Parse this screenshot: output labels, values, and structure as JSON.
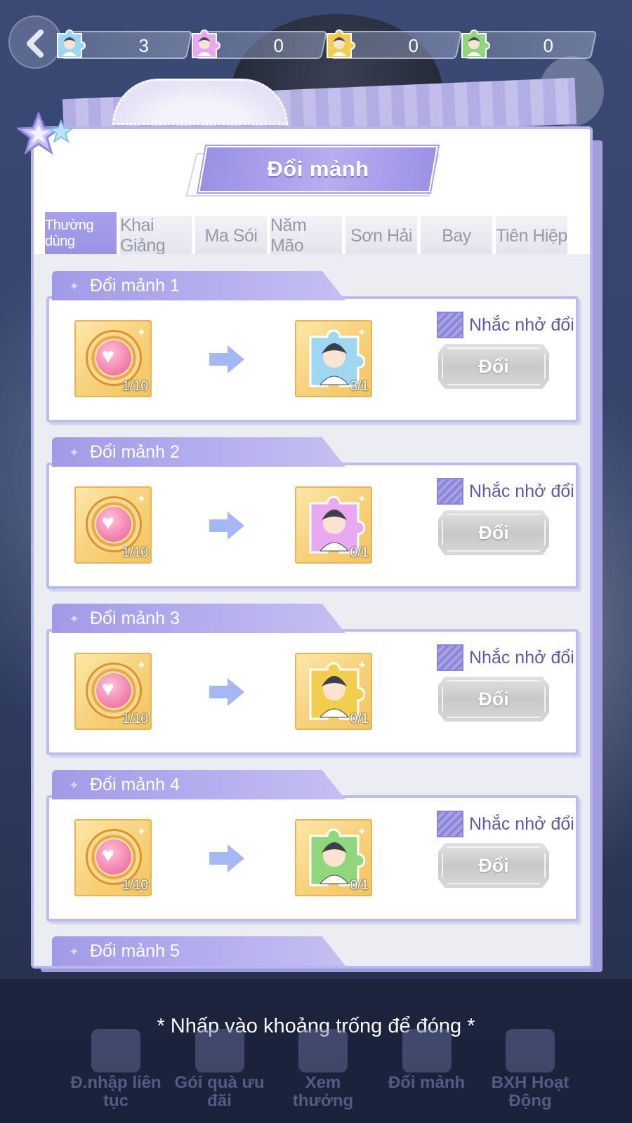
{
  "resources": [
    {
      "icon": "character-1-puzzle-icon",
      "value": "3"
    },
    {
      "icon": "character-2-puzzle-icon",
      "value": "0"
    },
    {
      "icon": "character-3-puzzle-icon",
      "value": "0"
    },
    {
      "icon": "character-4-puzzle-icon",
      "value": "0"
    }
  ],
  "panel": {
    "title": "Đổi mảnh"
  },
  "tabs": [
    {
      "label": "Thường dùng",
      "active": true
    },
    {
      "label": "Khai Giảng",
      "active": false
    },
    {
      "label": "Ma Sói",
      "active": false
    },
    {
      "label": "Năm Mão",
      "active": false
    },
    {
      "label": "Sơn Hải",
      "active": false
    },
    {
      "label": "Bay",
      "active": false
    },
    {
      "label": "Tiên Hiệp",
      "active": false
    }
  ],
  "items": [
    {
      "name": "Đổi mảnh 1",
      "cost": "1/10",
      "reward": "3/1",
      "remind_label": "Nhắc nhở đổi",
      "button_label": "Đổi",
      "puzzle_color": "#9fd6f2"
    },
    {
      "name": "Đổi mảnh 2",
      "cost": "1/10",
      "reward": "0/1",
      "remind_label": "Nhắc nhở đổi",
      "button_label": "Đổi",
      "puzzle_color": "#e9a9f0"
    },
    {
      "name": "Đổi mảnh 3",
      "cost": "1/10",
      "reward": "0/1",
      "remind_label": "Nhắc nhở đổi",
      "button_label": "Đổi",
      "puzzle_color": "#f3cd4e"
    },
    {
      "name": "Đổi mảnh 4",
      "cost": "1/10",
      "reward": "0/1",
      "remind_label": "Nhắc nhở đổi",
      "button_label": "Đổi",
      "puzzle_color": "#8fd67c"
    },
    {
      "name": "Đổi mảnh 5"
    }
  ],
  "footer": {
    "close_hint": "* Nhấp vào khoảng trống để đóng *",
    "nav": [
      {
        "label": "Đ.nhập liên tục"
      },
      {
        "label": "Gói quà ưu đãi"
      },
      {
        "label": "Xem thưởng"
      },
      {
        "label": "Đổi mảnh"
      },
      {
        "label": "BXH Hoạt Động"
      }
    ]
  },
  "colors": {
    "accent": "#9b92e4",
    "panel_border": "#b5b5ef",
    "reward_slot": "#f7d079"
  }
}
